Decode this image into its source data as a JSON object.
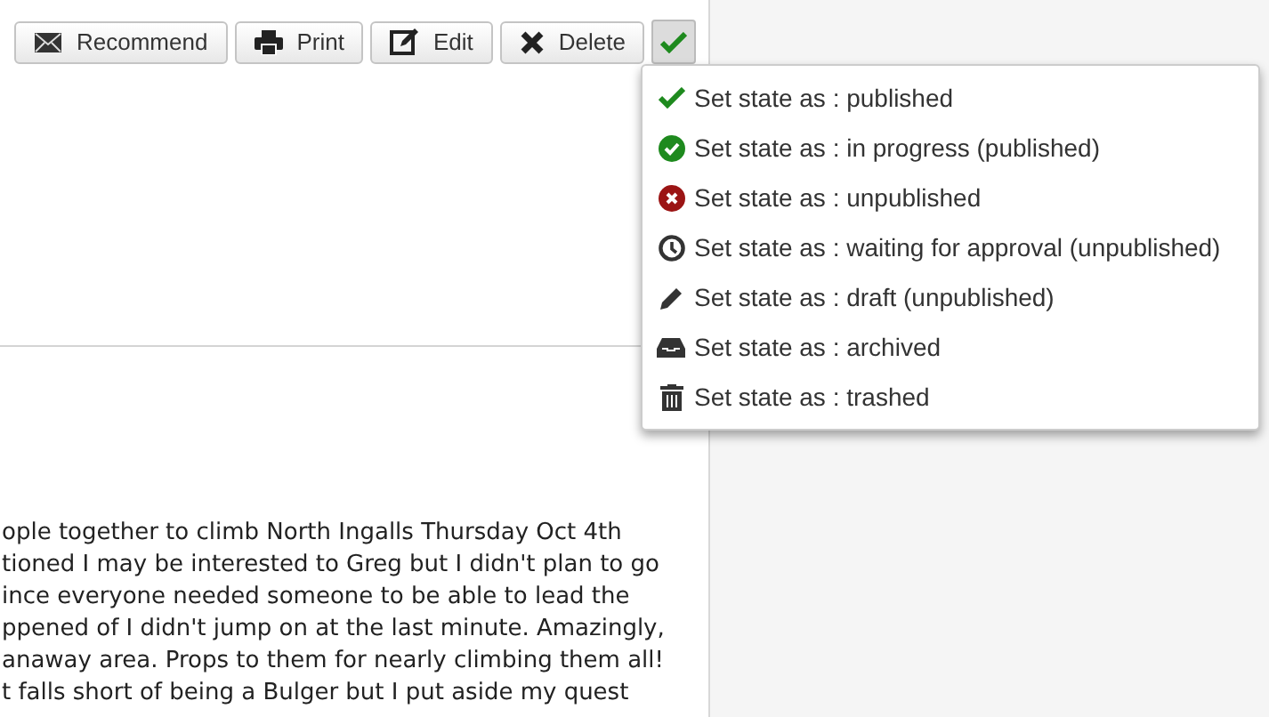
{
  "toolbar": {
    "buttons": [
      {
        "kind": "envelope",
        "label": "Recommend"
      },
      {
        "kind": "printer",
        "label": "Print"
      },
      {
        "kind": "edit",
        "label": "Edit"
      },
      {
        "kind": "cross",
        "label": "Delete"
      }
    ]
  },
  "state_menu": {
    "expanded": true,
    "items": [
      {
        "kind": "check",
        "label": "Set state as : published"
      },
      {
        "kind": "check-circle",
        "label": "Set state as : in progress (published)"
      },
      {
        "kind": "cross-circle",
        "label": "Set state as : unpublished"
      },
      {
        "kind": "clock",
        "label": "Set state as : waiting for approval (unpublished)"
      },
      {
        "kind": "pencil",
        "label": "Set state as : draft (unpublished)"
      },
      {
        "kind": "tray",
        "label": "Set state as : archived"
      },
      {
        "kind": "trash",
        "label": "Set state as : trashed"
      }
    ]
  },
  "article": {
    "lines": [
      "ople together to climb North Ingalls Thursday Oct 4th",
      "tioned I may be interested to Greg but I didn't plan to go",
      "ince everyone needed someone to be able to lead the",
      "ppened of I didn't jump on at the last minute. Amazingly,",
      "anaway area. Props to them for nearly climbing them all!",
      "t falls short of being a Bulger but I put aside my quest"
    ]
  }
}
